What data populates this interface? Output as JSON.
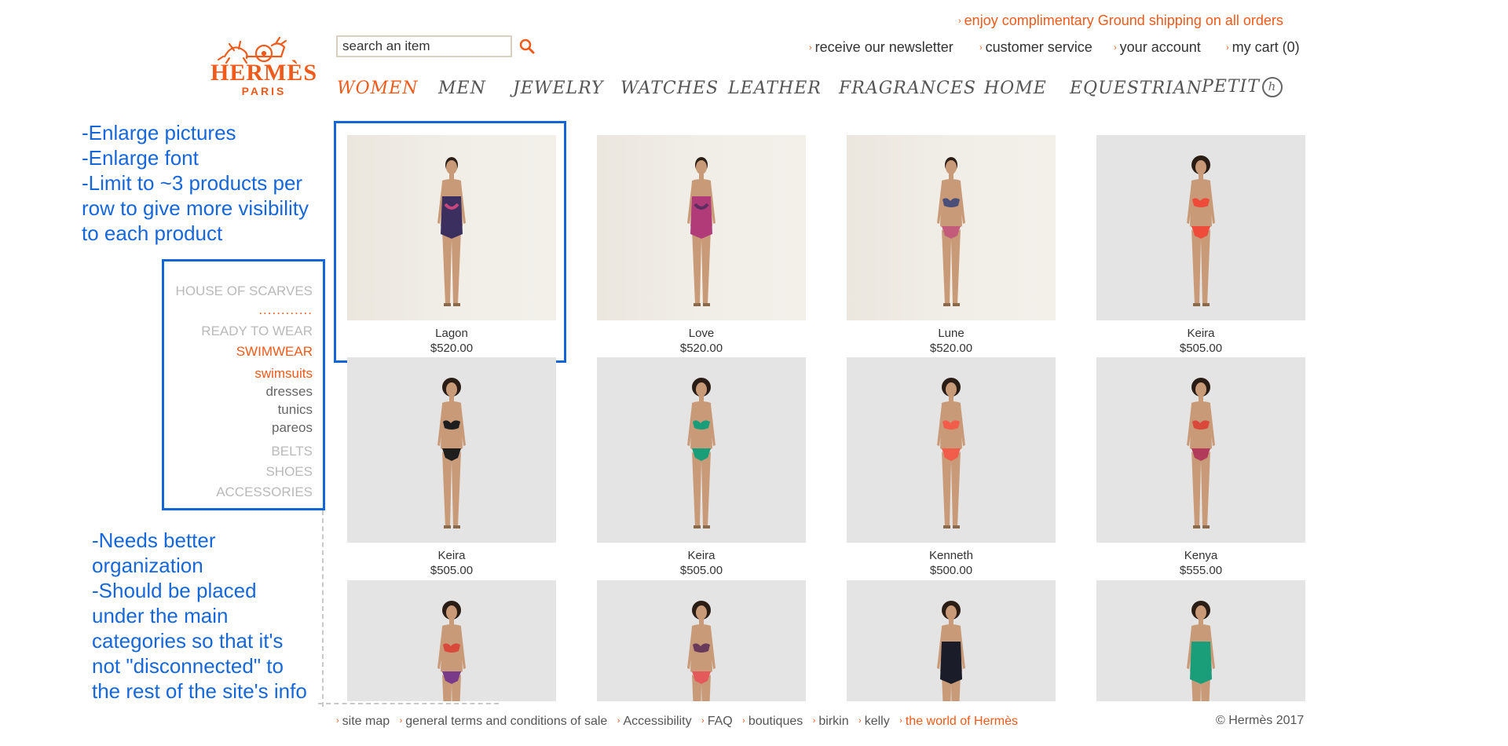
{
  "header": {
    "promo": "enjoy complimentary Ground shipping on all orders",
    "logo": {
      "word": "HERMÈS",
      "city": "PARIS"
    },
    "search": {
      "placeholder": "search an item"
    },
    "util_links": [
      "receive our newsletter",
      "customer service",
      "your account",
      "my cart (0)"
    ]
  },
  "nav": {
    "items": [
      "WOMEN",
      "MEN",
      "JEWELRY",
      "WATCHES",
      "LEATHER",
      "FRAGRANCES",
      "HOME",
      "EQUESTRIAN",
      "PETIT"
    ],
    "active": "WOMEN",
    "petit_mark": "h"
  },
  "annotations": {
    "top": [
      "-Enlarge pictures",
      "-Enlarge font",
      "-Limit to ~3 products per",
      "row to give more visibility",
      "to each product"
    ],
    "bottom": [
      "-Needs better",
      "organization",
      "-Should be placed",
      "under the main",
      "categories so that it's",
      "not \"disconnected\" to",
      "the rest of the site's info"
    ]
  },
  "sidebar": {
    "house": "HOUSE OF SCARVES",
    "dots": "............",
    "ready": "READY TO WEAR",
    "swimwear": "SWIMWEAR",
    "subs": [
      "swimsuits",
      "dresses",
      "tunics",
      "pareos"
    ],
    "active_sub": "swimsuits",
    "others": [
      "BELTS",
      "SHOES",
      "ACCESSORIES"
    ]
  },
  "products": [
    {
      "name": "Lagon",
      "price": "$520.00",
      "swimsuit": "one-piece",
      "color": "#3a2f5e",
      "accent": "#c8467e",
      "bg": "warm"
    },
    {
      "name": "Love",
      "price": "$520.00",
      "swimsuit": "one-piece",
      "color": "#b13a78",
      "accent": "#5b2e5e",
      "bg": "warm"
    },
    {
      "name": "Lune",
      "price": "$520.00",
      "swimsuit": "bikini",
      "color": "#4a4f7a",
      "accent": "#c25c7a",
      "bg": "warm"
    },
    {
      "name": "Keira",
      "price": "$505.00",
      "swimsuit": "bikini",
      "color": "#ee4b3b",
      "accent": "#ee4b3b",
      "bg": "grey"
    },
    {
      "name": "Keira",
      "price": "$505.00",
      "swimsuit": "bikini",
      "color": "#1e1e1e",
      "accent": "#1e1e1e",
      "bg": "grey"
    },
    {
      "name": "Keira",
      "price": "$505.00",
      "swimsuit": "bikini",
      "color": "#1a9e7a",
      "accent": "#1a9e7a",
      "bg": "grey"
    },
    {
      "name": "Kenneth",
      "price": "$500.00",
      "swimsuit": "bikini",
      "color": "#f25c4a",
      "accent": "#f25c4a",
      "bg": "grey"
    },
    {
      "name": "Kenya",
      "price": "$555.00",
      "swimsuit": "bikini",
      "color": "#d8493c",
      "accent": "#b23a5a",
      "bg": "grey"
    },
    {
      "name": "",
      "price": "",
      "swimsuit": "bikini",
      "color": "#d8493c",
      "accent": "#7a3a8a",
      "bg": "grey"
    },
    {
      "name": "",
      "price": "",
      "swimsuit": "bikini",
      "color": "#6a3a5a",
      "accent": "#e45a5a",
      "bg": "grey"
    },
    {
      "name": "",
      "price": "",
      "swimsuit": "one-piece",
      "color": "#1b1c2a",
      "accent": "#1b1c2a",
      "bg": "grey"
    },
    {
      "name": "",
      "price": "",
      "swimsuit": "one-piece",
      "color": "#1a9e7a",
      "accent": "#1a9e7a",
      "bg": "grey"
    }
  ],
  "footer": {
    "links": [
      "site map",
      "general terms and conditions of sale",
      "Accessibility",
      "FAQ",
      "boutiques",
      "birkin",
      "kelly",
      "the world of Hermès"
    ],
    "copyright": "© Hermès 2017"
  },
  "colors": {
    "accent": "#f05a1a",
    "annotation": "#1466d6"
  }
}
